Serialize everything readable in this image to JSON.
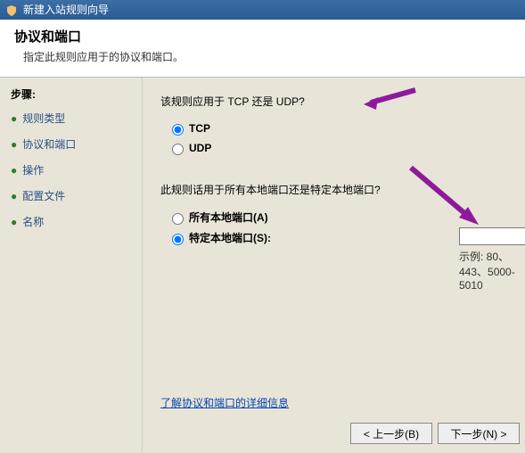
{
  "window": {
    "title": "新建入站规则向导"
  },
  "header": {
    "title": "协议和端口",
    "subtitle": "指定此规则应用于的协议和端口。"
  },
  "sidebar": {
    "steps_title": "步骤:",
    "items": [
      {
        "label": "规则类型"
      },
      {
        "label": "协议和端口"
      },
      {
        "label": "操作"
      },
      {
        "label": "配置文件"
      },
      {
        "label": "名称"
      }
    ]
  },
  "main": {
    "protocol_question": "该规则应用于 TCP 还是 UDP?",
    "option_tcp": "TCP",
    "option_udp": "UDP",
    "ports_question": "此规则话用于所有本地端口还是特定本地端口?",
    "option_all_ports": "所有本地端口(A)",
    "option_specific_ports": "特定本地端口(S):",
    "port_value": "",
    "port_placeholder": "",
    "example_label": "示例: 80、443、5000-5010",
    "learn_more": "了解协议和端口的详细信息"
  },
  "buttons": {
    "back": "< 上一步(B)",
    "next": "下一步(N) >"
  },
  "colors": {
    "accent_arrow": "#8e1a9b"
  }
}
